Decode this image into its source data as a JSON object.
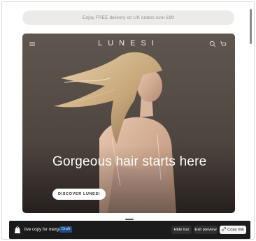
{
  "announcement": {
    "text": "Enjoy FREE delivery on UK orders over £90"
  },
  "header": {
    "logo": "LUNESI",
    "menu_icon": "menu-icon",
    "search_icon": "search-icon",
    "cart_icon": "cart-icon"
  },
  "hero": {
    "headline": "Gorgeous hair starts here",
    "cta_label": "DISCOVER LUNESI"
  },
  "preview_bar": {
    "store_icon": "shopify-bag-icon",
    "title": "live copy for merge",
    "badge": "Draft",
    "hide_bar_label": "Hide bar",
    "exit_preview_label": "Exit preview",
    "copy_link_label": "Copy link",
    "copy_link_icon": "link-icon"
  },
  "colors": {
    "hero_bg": "#574d47",
    "announcement_bg": "#ecebea",
    "bar_bg": "#1b1b1b",
    "badge_bg": "#1f4e8a"
  }
}
